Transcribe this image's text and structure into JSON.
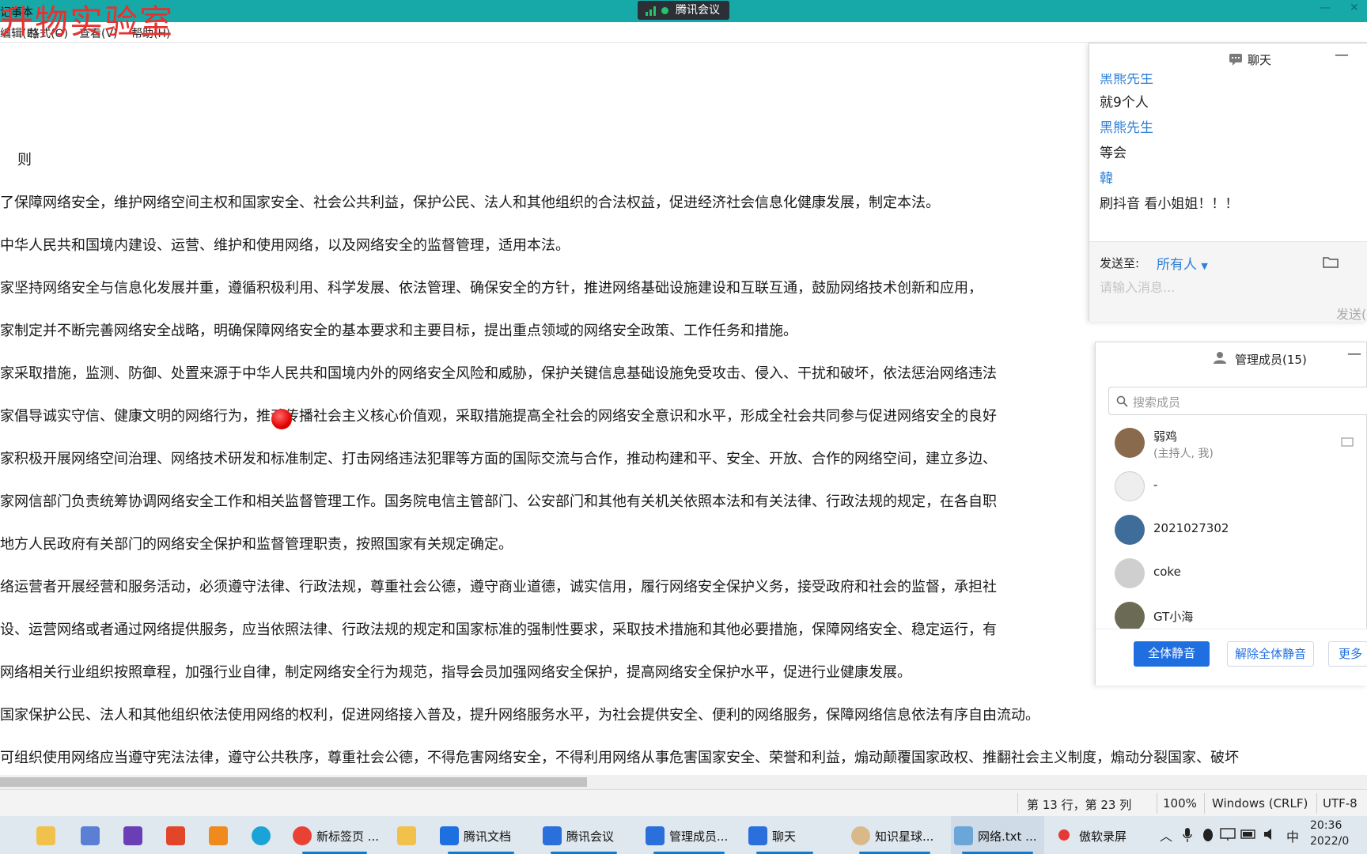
{
  "window": {
    "app_title": "记事本",
    "meeting_label": "腾讯会议",
    "watermark": "升物实验室",
    "minimize_glyph": "—",
    "close_glyph": "✕"
  },
  "menu": [
    "编辑(E)",
    "格式(O)",
    "查看(V)",
    "帮助(H)"
  ],
  "document": {
    "lines": [
      "则",
      "了保障网络安全，维护网络空间主权和国家安全、社会公共利益，保护公民、法人和其他组织的合法权益，促进经济社会信息化健康发展，制定本法。",
      "中华人民共和国境内建设、运营、维护和使用网络，以及网络安全的监督管理，适用本法。",
      "家坚持网络安全与信息化发展并重，遵循积极利用、科学发展、依法管理、确保安全的方针，推进网络基础设施建设和互联互通，鼓励网络技术创新和应用，",
      "家制定并不断完善网络安全战略，明确保障网络安全的基本要求和主要目标，提出重点领域的网络安全政策、工作任务和措施。",
      "家采取措施，监测、防御、处置来源于中华人民共和国境内外的网络安全风险和威胁，保护关键信息基础设施免受攻击、侵入、干扰和破坏，依法惩治网络违法",
      "家倡导诚实守信、健康文明的网络行为，推动传播社会主义核心价值观，采取措施提高全社会的网络安全意识和水平，形成全社会共同参与促进网络安全的良好",
      "家积极开展网络空间治理、网络技术研发和标准制定、打击网络违法犯罪等方面的国际交流与合作，推动构建和平、安全、开放、合作的网络空间，建立多边、",
      "家网信部门负责统筹协调网络安全工作和相关监督管理工作。国务院电信主管部门、公安部门和其他有关机关依照本法和有关法律、行政法规的规定，在各自职",
      "地方人民政府有关部门的网络安全保护和监督管理职责，按照国家有关规定确定。",
      "络运营者开展经营和服务活动，必须遵守法律、行政法规，尊重社会公德，遵守商业道德，诚实信用，履行网络安全保护义务，接受政府和社会的监督，承担社",
      "设、运营网络或者通过网络提供服务，应当依照法律、行政法规的规定和国家标准的强制性要求，采取技术措施和其他必要措施，保障网络安全、稳定运行，有",
      "网络相关行业组织按照章程，加强行业自律，制定网络安全行为规范，指导会员加强网络安全保护，提高网络安全保护水平，促进行业健康发展。",
      "国家保护公民、法人和其他组织依法使用网络的权利，促进网络接入普及，提升网络服务水平，为社会提供安全、便利的网络服务，保障网络信息依法有序自由流动。",
      "可组织使用网络应当遵守宪法法律，遵守公共秩序，尊重社会公德，不得危害网络安全，不得利用网络从事危害国家安全、荣誉和利益，煽动颠覆国家政权、推翻社会主义制度，煽动分裂国家、破坏"
    ]
  },
  "status": {
    "position": "第 13 行，第 23 列",
    "zoom": "100%",
    "line_ending": "Windows (CRLF)",
    "encoding": "UTF-8"
  },
  "chat": {
    "title": "聊天",
    "messages": [
      {
        "kind": "name",
        "text": "黑熊先生"
      },
      {
        "kind": "text",
        "text": "就9个人"
      },
      {
        "kind": "name",
        "text": "黑熊先生"
      },
      {
        "kind": "text",
        "text": "等会"
      },
      {
        "kind": "name",
        "text": "韓"
      },
      {
        "kind": "text",
        "text": "刷抖音 看小姐姐！！！"
      }
    ],
    "send_to_label": "发送至:",
    "send_to_target": "所有人",
    "input_placeholder": "请输入消息...",
    "send_label": "发送("
  },
  "members": {
    "title": "管理成员(15)",
    "search_placeholder": "搜索成员",
    "list": [
      {
        "name": "弱鸡",
        "sub": "(主持人, 我)",
        "color": "#8a6a4c"
      },
      {
        "name": "-",
        "sub": "",
        "color": "#e8e8e8"
      },
      {
        "name": "2021027302",
        "sub": "",
        "color": "#3f6d9a"
      },
      {
        "name": "coke",
        "sub": "",
        "color": "#cfcfcf"
      },
      {
        "name": "GT小海",
        "sub": "",
        "color": "#6b6b55"
      }
    ],
    "mute_all": "全体静音",
    "unmute_all": "解除全体静音",
    "more": "更多"
  },
  "taskbar": {
    "items": [
      {
        "label": "新标签页 ...",
        "color": "#e94235"
      },
      {
        "label": "",
        "color": "#f1c14c"
      },
      {
        "label": "腾讯文档",
        "color": "#1e6fe0"
      },
      {
        "label": "腾讯会议",
        "color": "#2a6fdb"
      },
      {
        "label": "管理成员...",
        "color": "#2a6fdb"
      },
      {
        "label": "聊天",
        "color": "#2a6fdb"
      },
      {
        "label": "知识星球...",
        "color": "#d9b98a"
      },
      {
        "label": "网络.txt ...",
        "color": "#6aa7d8"
      },
      {
        "label": "傲软录屏",
        "color": "#e53935"
      }
    ],
    "ime": "中",
    "time": "20:36",
    "date": "2022/0"
  }
}
